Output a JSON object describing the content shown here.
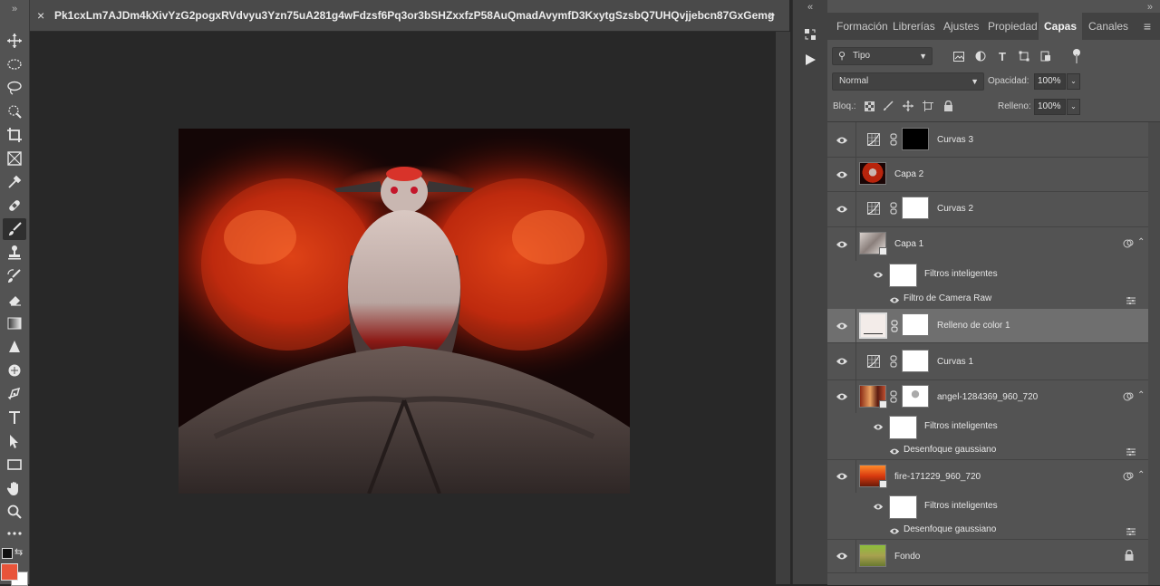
{
  "document": {
    "close_glyph": "×",
    "title": "Pk1cxLm7AJDm4kXivYzG2pogxRVdvyu3Yzn75uA281g4wFdzsf6Pq3or3bSHZxxfzP58AuQmadAvymfD3KxytgSzsbQ7UHQvjjebcn87GxGemg"
  },
  "tools": [
    {
      "name": "move-tool",
      "icon": "move-icon"
    },
    {
      "name": "marquee-tool",
      "icon": "ellipse-marquee-icon"
    },
    {
      "name": "lasso-tool",
      "icon": "lasso-icon"
    },
    {
      "name": "quick-selection-tool",
      "icon": "quick-selection-icon"
    },
    {
      "name": "crop-tool",
      "icon": "crop-icon"
    },
    {
      "name": "frame-tool",
      "icon": "frame-icon"
    },
    {
      "name": "eyedropper-tool",
      "icon": "eyedropper-icon"
    },
    {
      "name": "healing-brush-tool",
      "icon": "bandage-icon"
    },
    {
      "name": "brush-tool",
      "icon": "brush-icon",
      "active": true
    },
    {
      "name": "clone-stamp-tool",
      "icon": "stamp-icon"
    },
    {
      "name": "history-brush-tool",
      "icon": "history-brush-icon"
    },
    {
      "name": "eraser-tool",
      "icon": "eraser-icon"
    },
    {
      "name": "gradient-tool",
      "icon": "gradient-icon"
    },
    {
      "name": "blur-tool",
      "icon": "blur-icon"
    },
    {
      "name": "dodge-tool",
      "icon": "dodge-icon"
    },
    {
      "name": "pen-tool",
      "icon": "pen-icon"
    },
    {
      "name": "type-tool",
      "icon": "type-icon"
    },
    {
      "name": "path-selection-tool",
      "icon": "arrow-icon"
    },
    {
      "name": "rectangle-tool",
      "icon": "rectangle-icon"
    },
    {
      "name": "hand-tool",
      "icon": "hand-icon"
    },
    {
      "name": "zoom-tool",
      "icon": "zoom-icon"
    },
    {
      "name": "more-tools",
      "icon": "ellipsis-icon"
    }
  ],
  "colors": {
    "foreground": "#e8543a",
    "background": "#ffffff",
    "panel_bg": "#535353",
    "selected_row": "#6f6f6f"
  },
  "panel": {
    "tabs": [
      "Formación",
      "Librerías",
      "Ajustes",
      "Propiedades",
      "Capas",
      "Canales"
    ],
    "active_tab": "Capas",
    "filter_kind": "Tipo",
    "blend_mode": "Normal",
    "opacity_label": "Opacidad:",
    "opacity_value": "100%",
    "lock_label": "Bloq.:",
    "fill_label": "Relleno:",
    "fill_value": "100%"
  },
  "layers": [
    {
      "name": "Curvas 3",
      "kind": "curves",
      "mask": "black"
    },
    {
      "name": "Capa 2",
      "kind": "pixel",
      "thumb": "angel"
    },
    {
      "name": "Curvas 2",
      "kind": "curves",
      "mask": "white"
    },
    {
      "name": "Capa 1",
      "kind": "smart",
      "thumb": "angel2"
    },
    {
      "name": "Filtros inteligentes",
      "kind": "smart-filters"
    },
    {
      "name": "Filtro de Camera Raw",
      "kind": "filter"
    },
    {
      "name": "Relleno de color 1",
      "kind": "fill",
      "selected": true
    },
    {
      "name": "Curvas 1",
      "kind": "curves",
      "mask": "white"
    },
    {
      "name": "angel-1284369_960_720",
      "kind": "smart-masked",
      "thumb": "angel3"
    },
    {
      "name": "Filtros inteligentes",
      "kind": "smart-filters"
    },
    {
      "name": "Desenfoque gaussiano",
      "kind": "filter"
    },
    {
      "name": "fire-171229_960_720",
      "kind": "smart",
      "thumb": "fire"
    },
    {
      "name": "Filtros inteligentes",
      "kind": "smart-filters"
    },
    {
      "name": "Desenfoque gaussiano",
      "kind": "filter"
    },
    {
      "name": "Fondo",
      "kind": "background",
      "thumb": "landscape"
    }
  ]
}
